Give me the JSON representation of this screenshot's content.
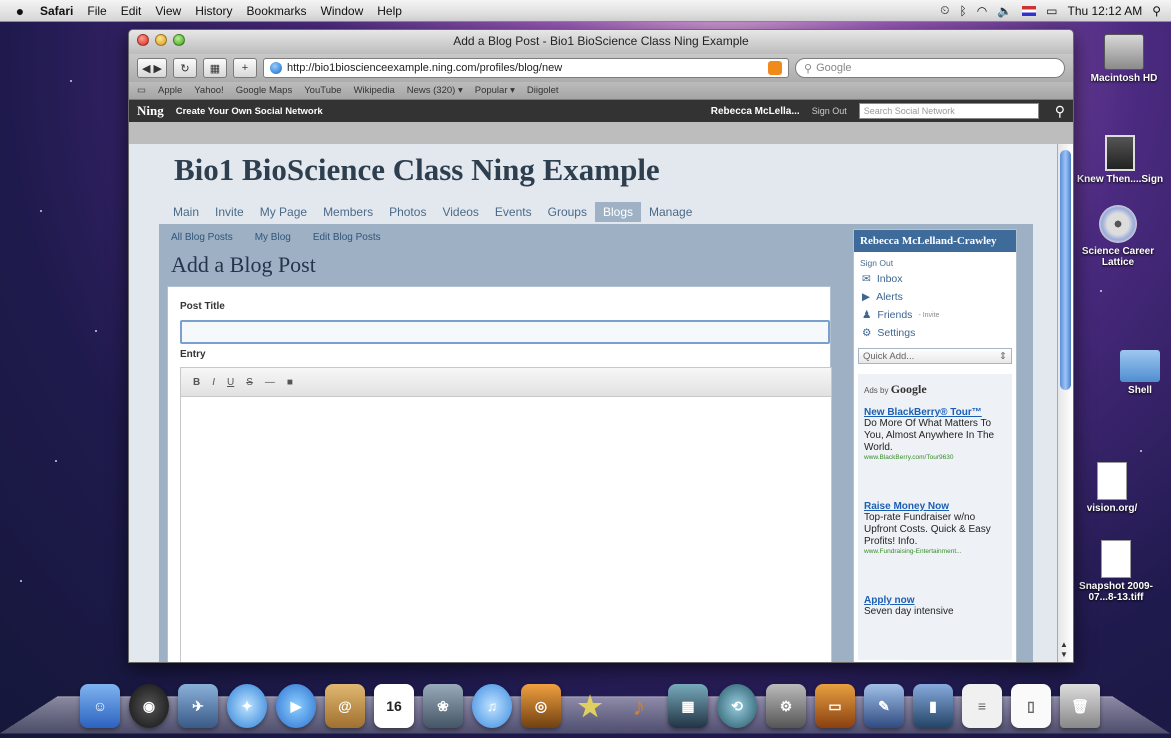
{
  "menubar": {
    "app": "Safari",
    "items": [
      "File",
      "Edit",
      "View",
      "History",
      "Bookmarks",
      "Window",
      "Help"
    ],
    "clock": "Thu 12:12 AM"
  },
  "window": {
    "title": "Add a Blog Post - Bio1 BioScience Class Ning Example",
    "url": "http://bio1bioscienceexample.ning.com/profiles/blog/new",
    "search_placeholder": "Google",
    "bookmarks": [
      "Apple",
      "Yahoo!",
      "Google Maps",
      "YouTube",
      "Wikipedia",
      "News (320) ▾",
      "Popular ▾",
      "Diigolet"
    ]
  },
  "ningbar": {
    "logo": "Ning",
    "create": "Create Your Own Social Network",
    "user": "Rebecca McLella...",
    "signout": "Sign Out",
    "search_placeholder": "Search Social Network"
  },
  "site": {
    "title": "Bio1 BioScience Class Ning Example",
    "tabs": [
      "Main",
      "Invite",
      "My Page",
      "Members",
      "Photos",
      "Videos",
      "Events",
      "Groups",
      "Blogs",
      "Manage"
    ],
    "active_tab": "Blogs",
    "subnav": [
      "All Blog Posts",
      "My Blog",
      "Edit Blog Posts"
    ],
    "page_title": "Add a Blog Post",
    "post_title_label": "Post Title",
    "entry_label": "Entry",
    "rte_buttons": [
      "B",
      "I",
      "U",
      "S",
      "—",
      "■"
    ]
  },
  "sidebar": {
    "user": "Rebecca McLelland-Crawley",
    "signout": "Sign Out",
    "items": [
      {
        "icon": "inbox-icon",
        "label": "Inbox",
        "extra": ""
      },
      {
        "icon": "alerts-icon",
        "label": "Alerts",
        "extra": ""
      },
      {
        "icon": "friends-icon",
        "label": "Friends",
        "extra": "- Invite"
      },
      {
        "icon": "settings-icon",
        "label": "Settings",
        "extra": ""
      }
    ],
    "quick_add": "Quick Add...",
    "ads_by": "Ads by",
    "ads_brand": "Google",
    "ads": [
      {
        "title": "New BlackBerry® Tour™",
        "text": "Do More Of What Matters To You, Almost Anywhere In The World.",
        "url": "www.BlackBerry.com/Tour9630"
      },
      {
        "title": "Raise Money Now",
        "text": "Top-rate Fundraiser w/no Upfront Costs. Quick & Easy Profits! Info.",
        "url": "www.Fundraising-Entertainment..."
      },
      {
        "title": "Apply now",
        "text": "Seven day intensive",
        "url": ""
      }
    ]
  },
  "desktop": {
    "icons": [
      "Macintosh HD",
      "Knew Then....Sign",
      "Science Career Lattice",
      "Shell",
      "vision.org/",
      "Snapshot 2009-07...8-13.tiff"
    ]
  },
  "colors": {
    "ning_bar": "#333333",
    "panel": "#9eb1c4",
    "sidebar_head": "#3e6b9a",
    "ad_link": "#1b5fb5"
  }
}
